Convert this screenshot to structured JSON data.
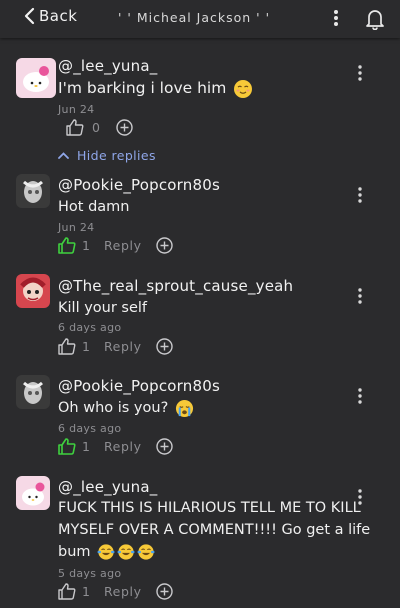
{
  "header": {
    "back_label": "Back",
    "title": "' ' Micheal Jackson ' ' "
  },
  "main_comment": {
    "username": "@_lee_yuna_",
    "text": "I'm barking i love him",
    "emoji": "relieved-face",
    "date": "Jun 24",
    "likes": "0"
  },
  "hide_replies_label": "Hide replies",
  "replies": [
    {
      "username": "@Pookie_Popcorn80s",
      "text": "Hot damn",
      "date": "Jun 24",
      "likes": "1",
      "liked": true,
      "reply_label": "Reply"
    },
    {
      "username": "@The_real_sprout_cause_yeah",
      "text": "Kill your self",
      "date": "6 days ago",
      "likes": "1",
      "liked": false,
      "reply_label": "Reply"
    },
    {
      "username": "@Pookie_Popcorn80s",
      "text": "Oh who is you?",
      "emoji": "crying-face",
      "date": "6 days ago",
      "likes": "1",
      "liked": true,
      "reply_label": "Reply"
    },
    {
      "username": "@_lee_yuna_",
      "text_line1": "FUCK THIS IS HILARIOUS TELL ME TO KILL",
      "text_line2": "MYSELF OVER A COMMENT!!!! Go get a life",
      "text_line3": "bum",
      "emoji": "tears-of-joy x3",
      "date": "5 days ago",
      "likes": "1",
      "liked": false,
      "reply_label": "Reply"
    }
  ],
  "colors": {
    "background": "#2b2b2d",
    "link": "#8fa6e8",
    "liked": "#3fd13f",
    "muted": "#8e8e92"
  }
}
